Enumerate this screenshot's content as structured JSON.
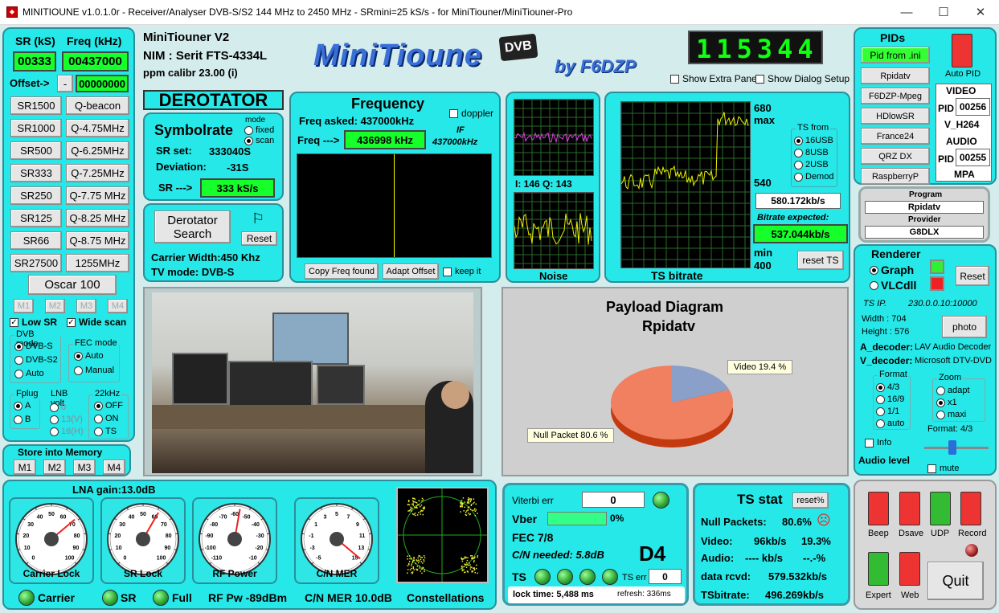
{
  "window": {
    "title": "MINITIOUNE v1.0.1.0r - Receiver/Analyser DVB-S/S2 144 MHz to 2450 MHz - SRmini=25 kS/s - for MiniTiouner/MiniTiouner-Pro",
    "minimize": "—",
    "maximize": "☐",
    "close": "✕"
  },
  "left": {
    "sr_label": "SR (kS)",
    "freq_label": "Freq (kHz)",
    "sr_value": "00333",
    "freq_value": "00437000",
    "offset_label": "Offset->",
    "offset_sign": "-",
    "offset_value": "00000000",
    "sr_buttons": [
      "SR1500",
      "SR1000",
      "SR500",
      "SR333",
      "SR250",
      "SR125",
      "SR66",
      "SR27500"
    ],
    "freq_buttons": [
      "Q-beacon",
      "Q-4.75MHz",
      "Q-6.25MHz",
      "Q-7.25MHz",
      "Q-7.75 MHz",
      "Q-8.25 MHz",
      "Q-8.75 MHz",
      "1255MHz"
    ],
    "oscar": "Oscar 100",
    "mem": [
      "M1",
      "M2",
      "M3",
      "M4"
    ],
    "low_sr": "Low SR",
    "wide_scan": "Wide scan",
    "dvb_mode": "DVB mode",
    "dvb_opts": [
      "DVB-S",
      "DVB-S2",
      "Auto"
    ],
    "fec_mode": "FEC mode",
    "fec_opts": [
      "Auto",
      "Manual"
    ],
    "fplug": "Fplug",
    "fplug_opts": [
      "A",
      "B"
    ],
    "lnb": "LNB volt",
    "lnb_opts": [
      "0",
      "13(V)",
      "18(H)"
    ],
    "khz": "22kHz",
    "khz_opts": [
      "OFF",
      "ON",
      "TS"
    ],
    "store": "Store into Memory",
    "store_mem": [
      "M1",
      "M2",
      "M3",
      "M4"
    ]
  },
  "header": {
    "name": "MiniTiouner V2",
    "nim": "NIM : Serit FTS-4334L",
    "ppm": "ppm calibr  23.00 (i)",
    "logo": "MiniTioune",
    "logo_dvb": "DVB",
    "logo_by": "by F6DZP",
    "clock": "115344",
    "show_extra": "Show Extra Panel",
    "show_dialog": "Show Dialog Setup"
  },
  "derot": {
    "title": "DEROTATOR",
    "symbolrate": "Symbolrate",
    "mode": "mode",
    "fixed": "fixed",
    "scan": "scan",
    "sr_set_l": "SR set:",
    "sr_set_v": "333040S",
    "dev_l": "Deviation:",
    "dev_v": "-31S",
    "sr_arrow": "SR --->",
    "sr_val": "333 kS/s",
    "search": "Derotator Search",
    "reset": "Reset",
    "carrier": "Carrier Width:450 Khz",
    "tvmode": "TV mode: DVB-S"
  },
  "freq": {
    "title": "Frequency",
    "doppler": "doppler",
    "asked": "Freq asked: 437000kHz",
    "arrow": "Freq --->",
    "value": "436998 kHz",
    "if_l": "IF",
    "if_v": "437000kHz",
    "copy": "Copy Freq found",
    "adapt": "Adapt Offset",
    "keep": "keep it"
  },
  "iq": {
    "label": "I: 146  Q: 143",
    "noise": "Noise"
  },
  "ts_bitrate": {
    "max_v": "680",
    "max_l": "max",
    "mid": "540",
    "min_l": "min",
    "min_v": "400",
    "from": "TS from",
    "opts": [
      "16USB",
      "8USB",
      "2USB",
      "Demod"
    ],
    "rate": "580.172kb/s",
    "expected_l": "Bitrate expected:",
    "expected_v": "537.044kb/s",
    "reset": "reset TS",
    "title": "TS bitrate"
  },
  "pids": {
    "title": "PIDs",
    "from_ini": "Pid from .ini",
    "auto": "Auto PID",
    "names": [
      "Rpidatv",
      "F6DZP-Mpeg",
      "HDlowSR",
      "France24",
      "QRZ DX",
      "RaspberryP"
    ],
    "video": "VIDEO",
    "pid_l": "PID",
    "video_pid": "00256",
    "v_codec": "V_H264",
    "audio": "AUDIO",
    "audio_pid": "00255",
    "a_codec": "MPA"
  },
  "program": {
    "prog_l": "Program",
    "prog_v": "Rpidatv",
    "prov_l": "Provider",
    "prov_v": "G8DLX"
  },
  "renderer": {
    "title": "Renderer",
    "graph": "Graph",
    "vlc": "VLCdll",
    "reset": "Reset",
    "ts_ip": "TS IP.",
    "ts_ip_v": "230.0.0.10:10000",
    "width": "Width :  704",
    "height": "Height :  576",
    "photo": "photo",
    "a_dec": "A_decoder:",
    "a_dec_v": "LAV Audio Decoder",
    "v_dec": "V_decoder:",
    "v_dec_v": "Microsoft DTV-DVD V",
    "format": "Format",
    "fmt": [
      "4/3",
      "16/9",
      "1/1",
      "auto"
    ],
    "zoom": "Zoom",
    "zm": [
      "adapt",
      "x1",
      "maxi"
    ],
    "fmt_l": "Format:  4/3",
    "info": "Info",
    "audio_level": "Audio level",
    "mute": "mute",
    "audio_level_v": 0.5
  },
  "payload": {
    "title": "Payload Diagram",
    "sub": "Rpidatv",
    "video": "Video 19.4 %",
    "null": "Null Packet 80.6 %",
    "video_pct": 19.4,
    "null_pct": 80.6
  },
  "gauges": {
    "lna": "LNA gain:13.0dB",
    "g1": "Carrier Lock",
    "g2": "SR Lock",
    "g3": "RF Power",
    "g4": "C/N MER",
    "g1_ticks": [
      "0",
      "10",
      "20",
      "30",
      "40",
      "50",
      "60",
      "70",
      "80",
      "90",
      "100"
    ],
    "g3_ticks": [
      "-110",
      "-100",
      "-90",
      "-80",
      "-70",
      "-60",
      "-50",
      "-40",
      "-30",
      "-20",
      "-10"
    ],
    "g4_ticks": [
      "-5",
      "-3",
      "-1",
      "1",
      "3",
      "5",
      "7",
      "9",
      "11",
      "13",
      "15"
    ],
    "carrier": "Carrier",
    "sr": "SR",
    "full": "Full",
    "rfpw": "RF Pw  -89dBm",
    "cn": "C/N MER 10.0dB",
    "const": "Constellations"
  },
  "viterbi": {
    "err_l": "Viterbi err",
    "err_v": "0",
    "vber": "Vber",
    "vber_pct": "0%",
    "fec": "FEC 7/8",
    "cn": "C/N  needed:  5.8dB",
    "d4": "D4",
    "ts": "TS",
    "ts_err": "TS err",
    "ts_err_v": "0",
    "lock": "lock time: 5,488 ms",
    "refresh": "refresh: 336ms"
  },
  "tsstat": {
    "title": "TS stat",
    "reset": "reset%",
    "null_l": "Null Packets:",
    "null_v": "80.6%",
    "video_l": "Video:",
    "video_kb": "96kb/s",
    "video_pct": "19.3%",
    "audio_l": "Audio:",
    "audio_kb": "---- kb/s",
    "audio_pct": "--.-%",
    "rcvd_l": "data rcvd:",
    "rcvd_v": "579.532kb/s",
    "tsb_l": "TSbitrate:",
    "tsb_v": "496.269kb/s"
  },
  "switches": {
    "beep": "Beep",
    "dsave": "Dsave",
    "udp": "UDP",
    "record": "Record",
    "expert": "Expert",
    "web": "Web",
    "quit": "Quit"
  },
  "colors": {
    "panel": "#27e8e8",
    "lcd": "#16ff2a",
    "border": "#2a8f9a"
  }
}
